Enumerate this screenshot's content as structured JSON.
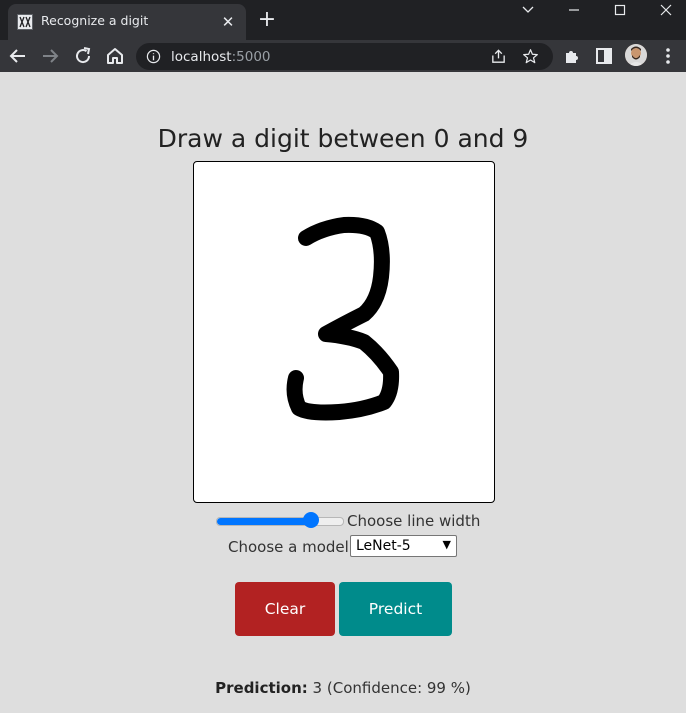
{
  "browser": {
    "tab_title": "Recognize a digit",
    "url_host": "localhost",
    "url_port": ":5000"
  },
  "page": {
    "heading": "Draw a digit between 0 and 9",
    "line_width_label": "Choose line width",
    "line_width_level": 0.75,
    "model_label": "Choose a model:",
    "model_selected": "LeNet-5",
    "clear_label": "Clear",
    "predict_label": "Predict",
    "prediction_label": "Prediction:",
    "prediction_digit": "3",
    "confidence_text": "(Confidence: 99 %)"
  },
  "colors": {
    "clear_button": "#b22222",
    "predict_button": "#008b8b",
    "slider_accent": "#0075ff",
    "page_background": "#dedede"
  },
  "icons": [
    "back-icon",
    "forward-icon",
    "reload-icon",
    "home-icon",
    "info-icon",
    "share-icon",
    "bookmark-star-icon",
    "extensions-icon",
    "side-panel-icon",
    "menu-icon"
  ]
}
